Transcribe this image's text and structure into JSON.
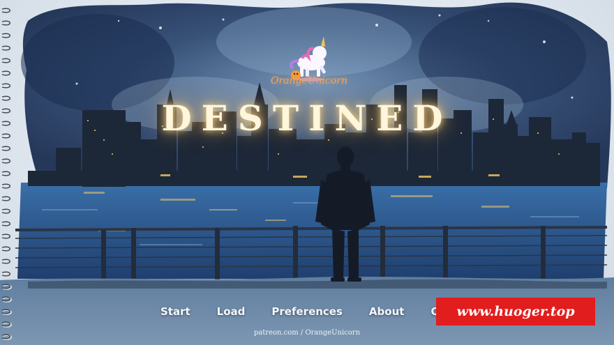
{
  "logo": {
    "text": "OrangeUnicorn"
  },
  "title": "DESTINED",
  "menu": {
    "items": [
      {
        "label": "Start"
      },
      {
        "label": "Load"
      },
      {
        "label": "Preferences"
      },
      {
        "label": "About"
      },
      {
        "label": "Qu"
      }
    ]
  },
  "footer": {
    "patreon": "patreon.com / OrangeUnicorn"
  },
  "watermark": {
    "text": "www.huoger.top"
  },
  "colors": {
    "title_glow": "#ffcc66",
    "logo_text": "#f3a25a",
    "watermark_bg": "#e11d1d",
    "menu_text": "#f4f7fb"
  }
}
